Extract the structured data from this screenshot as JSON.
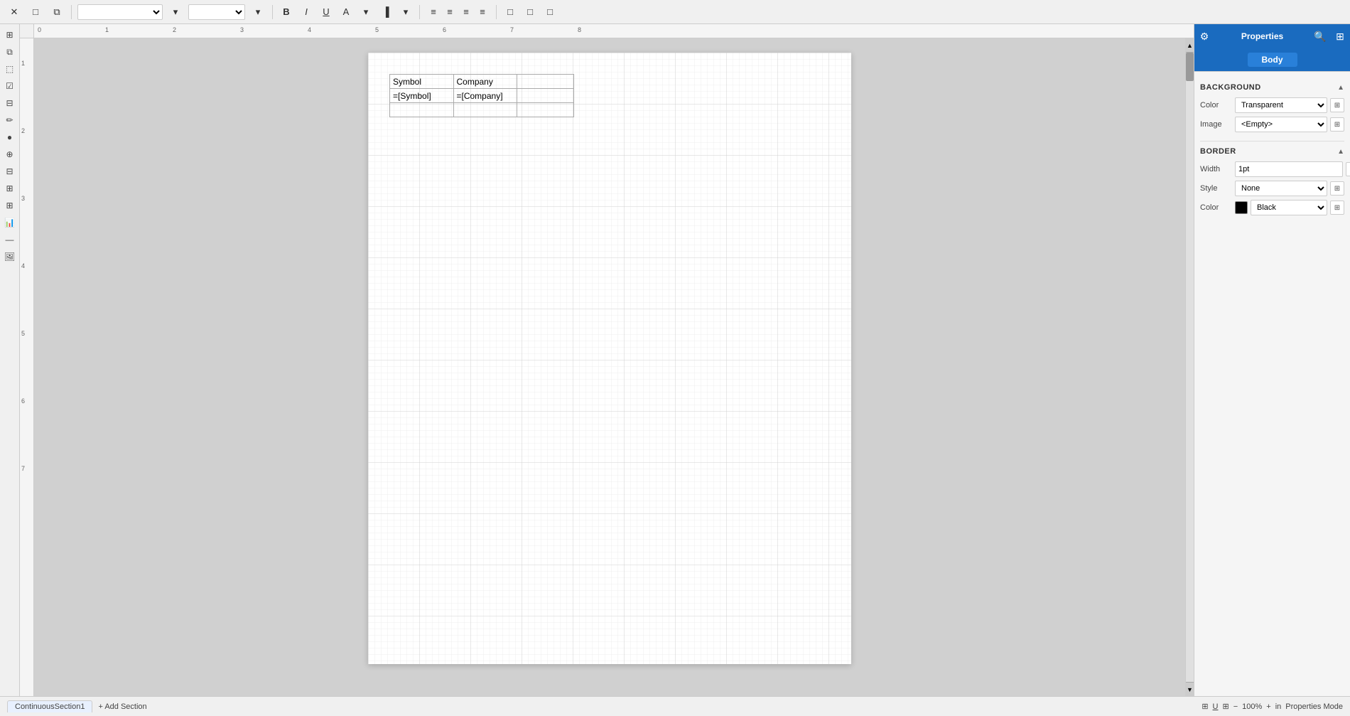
{
  "toolbar": {
    "buttons": [
      "✕",
      "□",
      "⧉"
    ],
    "fontFamily": "",
    "fontSize": "",
    "bold": "B",
    "italic": "I",
    "underline": "U",
    "fontColor": "A",
    "highlight": "▐",
    "alignLeft": "≡",
    "alignCenter": "≡",
    "alignRight": "≡",
    "alignJustify": "≡",
    "layoutBtn1": "□",
    "layoutBtn2": "□",
    "layoutBtn3": "□"
  },
  "leftSidebar": {
    "icons": [
      "⊞",
      "⧉",
      "⬚",
      "☑",
      "⊟",
      "✏",
      "🔵",
      "⊕",
      "⊟",
      "📊",
      "⊞",
      "📈",
      "—"
    ]
  },
  "ruler": {
    "labels": [
      "0",
      "1",
      "2",
      "3",
      "4",
      "5",
      "6",
      "7",
      "8"
    ],
    "vLabels": [
      "1",
      "2",
      "3",
      "4",
      "5",
      "6",
      "7"
    ]
  },
  "page": {
    "table": {
      "headers": [
        "Symbol",
        "Company",
        ""
      ],
      "rows": [
        [
          "=[Symbol]",
          "=[Company]",
          ""
        ]
      ]
    }
  },
  "rightPanel": {
    "tabs": [
      {
        "label": "Properties",
        "active": true
      },
      {
        "label": "",
        "icon": "≡"
      },
      {
        "label": "",
        "icon": "⊞"
      }
    ],
    "activeTab": "Properties",
    "bodyLabel": "Body",
    "searchIcon": "🔍",
    "sections": {
      "background": {
        "title": "BACKGROUND",
        "color": {
          "label": "Color",
          "value": "Transparent"
        },
        "image": {
          "label": "Image",
          "value": "<Empty>"
        }
      },
      "border": {
        "title": "BORDER",
        "width": {
          "label": "Width",
          "value": "1pt"
        },
        "style": {
          "label": "Style",
          "value": "None"
        },
        "color": {
          "label": "Color",
          "value": "Black",
          "swatch": "#000000"
        }
      }
    }
  },
  "bottomBar": {
    "tab": "ContinuousSection1",
    "addSection": "+ Add Section",
    "zoomMinus": "−",
    "zoomLevel": "100%",
    "zoomPlus": "+",
    "unit": "in",
    "gridIcon": "⊞",
    "underlineIcon": "U",
    "propertiesMode": "Properties Mode"
  }
}
